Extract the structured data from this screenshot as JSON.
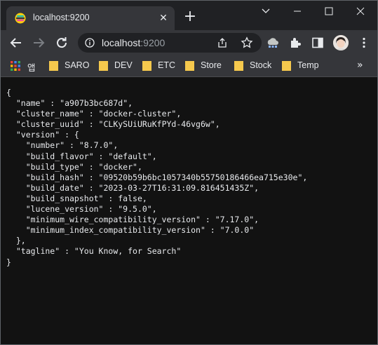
{
  "tab": {
    "title": "localhost:9200",
    "close_icon": "close-icon"
  },
  "window_controls": [
    "minimize",
    "maximize",
    "close"
  ],
  "address": {
    "host": "localhost",
    "port": ":9200"
  },
  "bookmarks": {
    "apps_label": "앱",
    "items": [
      "SARO",
      "DEV",
      "ETC",
      "Store",
      "Stock",
      "Temp"
    ],
    "more": "»"
  },
  "colors": {
    "folder": "#f6c94d",
    "content_bg": "#121212",
    "chrome_bg": "#35363a"
  },
  "json": {
    "name": "a907b3bc687d",
    "cluster_name": "docker-cluster",
    "cluster_uuid": "CLKySUiURuKfPYd-46vg6w",
    "version": {
      "number": "8.7.0",
      "build_flavor": "default",
      "build_type": "docker",
      "build_hash": "09520b59b6bc1057340b55750186466ea715e30e",
      "build_date": "2023-03-27T16:31:09.816451435Z",
      "build_snapshot": false,
      "lucene_version": "9.5.0",
      "minimum_wire_compatibility_version": "7.17.0",
      "minimum_index_compatibility_version": "7.0.0"
    },
    "tagline": "You Know, for Search"
  }
}
